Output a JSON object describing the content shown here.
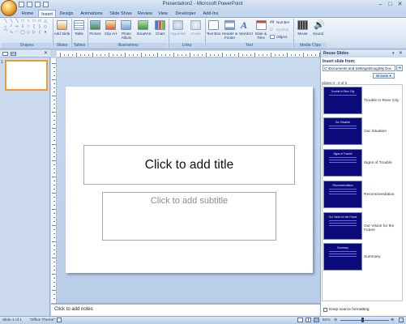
{
  "window": {
    "title": "Presentation2 - Microsoft PowerPoint",
    "controls": [
      "–",
      "□",
      "✕"
    ]
  },
  "tabs": [
    "Home",
    "Insert",
    "Design",
    "Animations",
    "Slide Show",
    "Review",
    "View",
    "Developer",
    "Add-Ins"
  ],
  "active_tab": "Insert",
  "ribbon": {
    "groups": [
      "Shapes",
      "Slides",
      "Tables",
      "Illustrations",
      "Links",
      "Text",
      "Media Clips"
    ],
    "buttons": {
      "add_slide": "Add Slide",
      "table": "Table",
      "picture": "Picture",
      "clip_art": "Clip Art",
      "photo_album": "Photo Album",
      "smartart": "SmartArt",
      "chart": "Chart",
      "hyperlink": "Hyperlink",
      "action": "Action",
      "text_box": "Text Box",
      "header_footer": "Header & Footer",
      "wordart": "WordArt",
      "date_time": "Date & Time",
      "slide_number": "Number",
      "symbol": "Symbol",
      "object": "Object",
      "movie": "Movie",
      "sound": "Sound"
    }
  },
  "slide_pane": {
    "thumb_number": "1"
  },
  "slide": {
    "title_placeholder": "Click to add title",
    "subtitle_placeholder": "Click to add subtitle"
  },
  "notes": {
    "placeholder": "Click to add notes"
  },
  "reuse_pane": {
    "header": "Reuse Slides",
    "close": "✕",
    "insert_from_label": "Insert slide from:",
    "path_value": "C:\\Documents and Settings\\Doug\\My Doc",
    "browse_label": "Browse ▾",
    "slides_count_label": "Slides 0 - 0 of 6",
    "slides": [
      {
        "thumb_title": "Trouble in River City",
        "label": "Trouble in River City"
      },
      {
        "thumb_title": "Our Situation",
        "label": "Our Situation"
      },
      {
        "thumb_title": "Signs of Trouble",
        "label": "Signs of Trouble"
      },
      {
        "thumb_title": "Recommendation",
        "label": "Recommendation"
      },
      {
        "thumb_title": "Our Vision for the Future",
        "label": "Our Vision for the Future"
      },
      {
        "thumb_title": "Summary",
        "label": "Summary"
      }
    ],
    "keep_formatting_label": "Keep source formatting"
  },
  "status": {
    "slide_info": "Slide 1 of 1",
    "theme": "\"Office Theme\"",
    "zoom": "81%"
  },
  "colors": {
    "accent": "#f39a2b",
    "thumb_bg": "#0a0a7a"
  }
}
